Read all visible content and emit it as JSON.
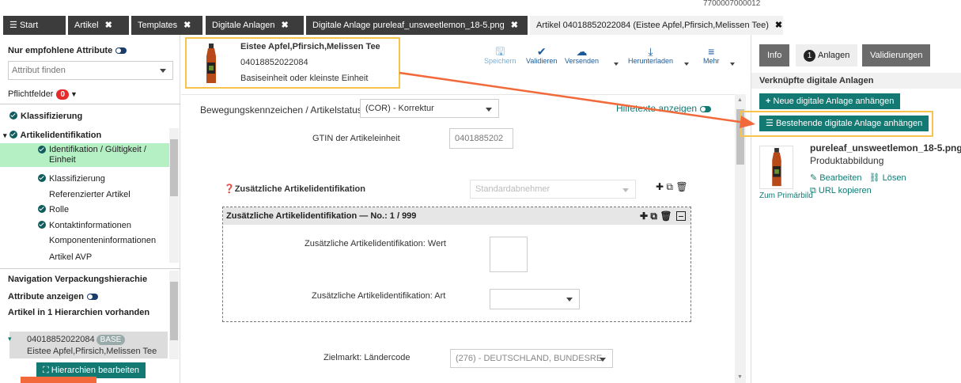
{
  "top": {
    "gtin_fragment": "7700007000012"
  },
  "tabs": [
    {
      "label": "Start",
      "icon": "hamburger-icon"
    },
    {
      "label": "Artikel"
    },
    {
      "label": "Templates"
    },
    {
      "label": "Digitale Anlagen"
    },
    {
      "label": "Digitale Anlage pureleaf_unsweetlemon_18-5.png"
    },
    {
      "label": "Artikel 04018852022084 (Eistee Apfel,Pfirsich,Melissen Tee)"
    }
  ],
  "left": {
    "recommended_label": "Nur empfohlene Attribute",
    "attr_placeholder": "Attribut finden",
    "required_label": "Pflichtfelder",
    "required_count": "0",
    "tree": [
      {
        "label": "Klassifizierung",
        "checked": true,
        "level": 0
      },
      {
        "label": "Artikelidentifikation",
        "checked": true,
        "level": 0,
        "expanded": true
      },
      {
        "label": "Identifikation / Gültigkeit /",
        "label2": "Einheit",
        "checked": true,
        "level": 1,
        "selected": true
      },
      {
        "label": "Klassifizierung",
        "checked": true,
        "level": 1
      },
      {
        "label": "Referenzierter Artikel",
        "checked": false,
        "level": 1
      },
      {
        "label": "Rolle",
        "checked": true,
        "level": 0
      },
      {
        "label": "Kontaktinformationen",
        "checked": true,
        "level": 1
      },
      {
        "label": "Komponenteninformationen",
        "checked": false,
        "level": 1
      },
      {
        "label": "Artikel AVP",
        "checked": false,
        "level": 1
      }
    ],
    "nav_title": "Navigation Verpackungshierachie",
    "show_attrs_label": "Attribute anzeigen",
    "hierarchies_label": "Artikel in 1 Hierarchien vorhanden",
    "hier_item": {
      "gtin": "04018852022084",
      "badge": "BASE",
      "name": "Eistee Apfel,Pfirsich,Melissen Tee"
    },
    "edit_hier_button": "Hierarchien bearbeiten"
  },
  "product": {
    "name": "Eistee Apfel,Pfirsich,Melissen Tee",
    "gtin": "04018852022084",
    "unit": "Basiseinheit oder kleinste Einheit"
  },
  "toolbar": [
    {
      "label": "Speichern",
      "icon": "save-icon",
      "glyph": "🖫",
      "dim": true
    },
    {
      "label": "Validieren",
      "icon": "check-icon",
      "glyph": "✔",
      "dim": false
    },
    {
      "label": "Versenden",
      "icon": "cloud-icon",
      "glyph": "☁",
      "dim": false
    },
    {
      "label": "Herunterladen",
      "icon": "download-icon",
      "glyph": "⤓",
      "dim": false
    },
    {
      "label": "Mehr",
      "icon": "menu-icon",
      "glyph": "≡",
      "dim": false
    }
  ],
  "form": {
    "status_label": "Bewegungskennzeichen / Artikelstatus",
    "status_value": "(COR) - Korrektur",
    "hint_label": "Hilfetexte anzeigen",
    "gtin_label": "GTIN der Artikeleinheit",
    "gtin_value": "0401885202",
    "add_id_label": "Zusätzliche Artikelidentifikation",
    "add_id_placeholder": "Standardabnehmer",
    "group_title": "Zusätzliche Artikelidentifikation — No.: 1 / 999",
    "value_label": "Zusätzliche Artikelidentifikation: Wert",
    "type_label": "Zusätzliche Artikelidentifikation: Art",
    "market_label": "Zielmarkt: Ländercode",
    "market_value": "(276) - DEUTSCHLAND, BUNDESRE"
  },
  "right": {
    "tab_info": "Info",
    "tab_anlagen": "Anlagen",
    "anlagen_count": "1",
    "tab_valid": "Validierungen",
    "section": "Verknüpfte digitale Anlagen",
    "new_button": "Neue digitale Anlage anhängen",
    "existing_button": "Bestehende digitale Anlage anhängen",
    "file_name": "pureleaf_unsweetlemon_18-5.png",
    "file_type": "Produktabbildung",
    "edit_link": "Bearbeiten",
    "unlink_link": "Lösen",
    "primary_link": "Zum Primärbild",
    "copy_url_link": "URL kopieren"
  },
  "colors": {
    "teal": "#127a73",
    "highlight": "#f7c34a",
    "arrow": "#f26a3b",
    "selected": "#b4f0c4"
  }
}
